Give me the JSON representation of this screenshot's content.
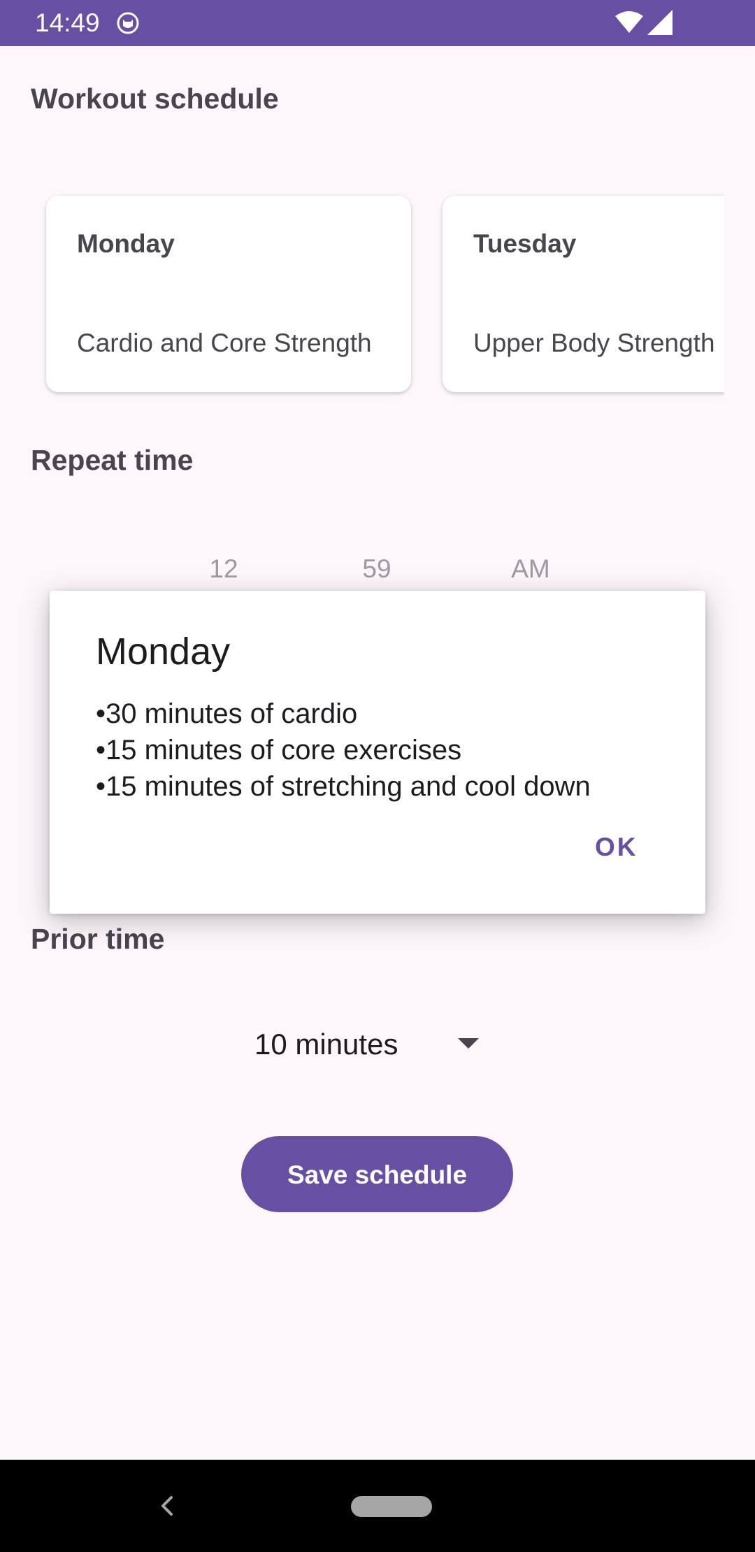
{
  "status_bar": {
    "time": "14:49",
    "icons": [
      "cat-notification-icon",
      "wifi-icon",
      "signal-icon"
    ]
  },
  "workout_schedule": {
    "title": "Workout schedule",
    "cards": [
      {
        "day": "Monday",
        "description": "Cardio and Core Strength"
      },
      {
        "day": "Tuesday",
        "description": "Upper Body Strength"
      }
    ]
  },
  "repeat_time": {
    "title": "Repeat time",
    "hour": "12",
    "minute": "59",
    "period": "AM"
  },
  "prior_time": {
    "title": "Prior time",
    "selected": "10 minutes",
    "icon": "dropdown-arrow-icon"
  },
  "save_button": {
    "label": "Save schedule"
  },
  "dialog": {
    "title": "Monday",
    "lines": [
      "•30 minutes of cardio",
      "•15 minutes of core exercises",
      "•15 minutes of stretching and cool down"
    ],
    "ok_label": "OK"
  },
  "navigation": {
    "icons": [
      "back-icon",
      "home-pill-icon"
    ]
  },
  "colors": {
    "primary": "#6750a4",
    "background": "#fdf7fc",
    "text": "#49454f",
    "muted": "#9e9aa3"
  }
}
